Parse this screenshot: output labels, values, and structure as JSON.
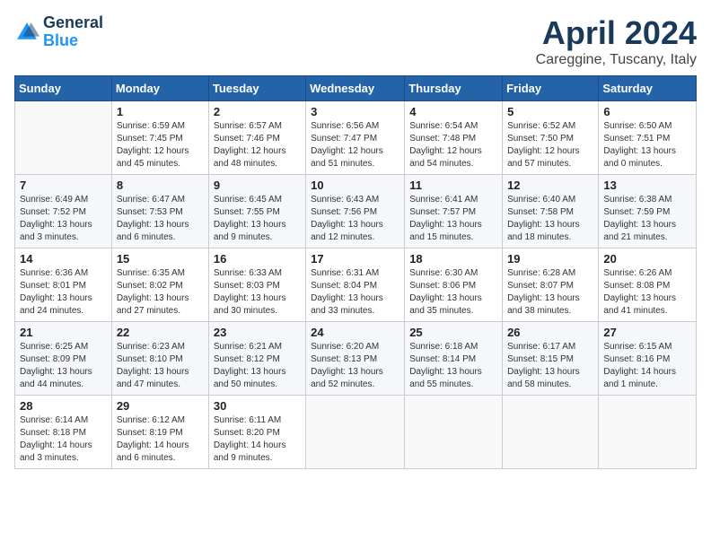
{
  "logo": {
    "line1": "General",
    "line2": "Blue"
  },
  "title": "April 2024",
  "subtitle": "Careggine, Tuscany, Italy",
  "header_days": [
    "Sunday",
    "Monday",
    "Tuesday",
    "Wednesday",
    "Thursday",
    "Friday",
    "Saturday"
  ],
  "weeks": [
    [
      {
        "day": "",
        "info": ""
      },
      {
        "day": "1",
        "info": "Sunrise: 6:59 AM\nSunset: 7:45 PM\nDaylight: 12 hours\nand 45 minutes."
      },
      {
        "day": "2",
        "info": "Sunrise: 6:57 AM\nSunset: 7:46 PM\nDaylight: 12 hours\nand 48 minutes."
      },
      {
        "day": "3",
        "info": "Sunrise: 6:56 AM\nSunset: 7:47 PM\nDaylight: 12 hours\nand 51 minutes."
      },
      {
        "day": "4",
        "info": "Sunrise: 6:54 AM\nSunset: 7:48 PM\nDaylight: 12 hours\nand 54 minutes."
      },
      {
        "day": "5",
        "info": "Sunrise: 6:52 AM\nSunset: 7:50 PM\nDaylight: 12 hours\nand 57 minutes."
      },
      {
        "day": "6",
        "info": "Sunrise: 6:50 AM\nSunset: 7:51 PM\nDaylight: 13 hours\nand 0 minutes."
      }
    ],
    [
      {
        "day": "7",
        "info": "Sunrise: 6:49 AM\nSunset: 7:52 PM\nDaylight: 13 hours\nand 3 minutes."
      },
      {
        "day": "8",
        "info": "Sunrise: 6:47 AM\nSunset: 7:53 PM\nDaylight: 13 hours\nand 6 minutes."
      },
      {
        "day": "9",
        "info": "Sunrise: 6:45 AM\nSunset: 7:55 PM\nDaylight: 13 hours\nand 9 minutes."
      },
      {
        "day": "10",
        "info": "Sunrise: 6:43 AM\nSunset: 7:56 PM\nDaylight: 13 hours\nand 12 minutes."
      },
      {
        "day": "11",
        "info": "Sunrise: 6:41 AM\nSunset: 7:57 PM\nDaylight: 13 hours\nand 15 minutes."
      },
      {
        "day": "12",
        "info": "Sunrise: 6:40 AM\nSunset: 7:58 PM\nDaylight: 13 hours\nand 18 minutes."
      },
      {
        "day": "13",
        "info": "Sunrise: 6:38 AM\nSunset: 7:59 PM\nDaylight: 13 hours\nand 21 minutes."
      }
    ],
    [
      {
        "day": "14",
        "info": "Sunrise: 6:36 AM\nSunset: 8:01 PM\nDaylight: 13 hours\nand 24 minutes."
      },
      {
        "day": "15",
        "info": "Sunrise: 6:35 AM\nSunset: 8:02 PM\nDaylight: 13 hours\nand 27 minutes."
      },
      {
        "day": "16",
        "info": "Sunrise: 6:33 AM\nSunset: 8:03 PM\nDaylight: 13 hours\nand 30 minutes."
      },
      {
        "day": "17",
        "info": "Sunrise: 6:31 AM\nSunset: 8:04 PM\nDaylight: 13 hours\nand 33 minutes."
      },
      {
        "day": "18",
        "info": "Sunrise: 6:30 AM\nSunset: 8:06 PM\nDaylight: 13 hours\nand 35 minutes."
      },
      {
        "day": "19",
        "info": "Sunrise: 6:28 AM\nSunset: 8:07 PM\nDaylight: 13 hours\nand 38 minutes."
      },
      {
        "day": "20",
        "info": "Sunrise: 6:26 AM\nSunset: 8:08 PM\nDaylight: 13 hours\nand 41 minutes."
      }
    ],
    [
      {
        "day": "21",
        "info": "Sunrise: 6:25 AM\nSunset: 8:09 PM\nDaylight: 13 hours\nand 44 minutes."
      },
      {
        "day": "22",
        "info": "Sunrise: 6:23 AM\nSunset: 8:10 PM\nDaylight: 13 hours\nand 47 minutes."
      },
      {
        "day": "23",
        "info": "Sunrise: 6:21 AM\nSunset: 8:12 PM\nDaylight: 13 hours\nand 50 minutes."
      },
      {
        "day": "24",
        "info": "Sunrise: 6:20 AM\nSunset: 8:13 PM\nDaylight: 13 hours\nand 52 minutes."
      },
      {
        "day": "25",
        "info": "Sunrise: 6:18 AM\nSunset: 8:14 PM\nDaylight: 13 hours\nand 55 minutes."
      },
      {
        "day": "26",
        "info": "Sunrise: 6:17 AM\nSunset: 8:15 PM\nDaylight: 13 hours\nand 58 minutes."
      },
      {
        "day": "27",
        "info": "Sunrise: 6:15 AM\nSunset: 8:16 PM\nDaylight: 14 hours\nand 1 minute."
      }
    ],
    [
      {
        "day": "28",
        "info": "Sunrise: 6:14 AM\nSunset: 8:18 PM\nDaylight: 14 hours\nand 3 minutes."
      },
      {
        "day": "29",
        "info": "Sunrise: 6:12 AM\nSunset: 8:19 PM\nDaylight: 14 hours\nand 6 minutes."
      },
      {
        "day": "30",
        "info": "Sunrise: 6:11 AM\nSunset: 8:20 PM\nDaylight: 14 hours\nand 9 minutes."
      },
      {
        "day": "",
        "info": ""
      },
      {
        "day": "",
        "info": ""
      },
      {
        "day": "",
        "info": ""
      },
      {
        "day": "",
        "info": ""
      }
    ]
  ]
}
